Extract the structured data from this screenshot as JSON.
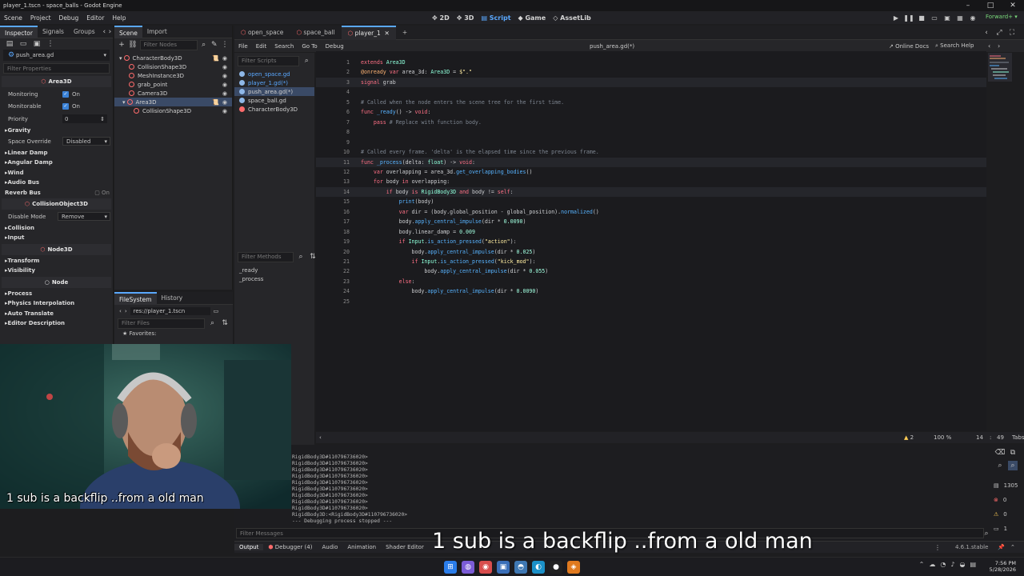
{
  "window": {
    "title": "player_1.tscn - space_balls - Godot Engine"
  },
  "menubar": {
    "items": [
      "Scene",
      "Project",
      "Debug",
      "Editor",
      "Help"
    ],
    "workspaces": [
      "2D",
      "3D",
      "Script",
      "Game",
      "AssetLib"
    ],
    "renderer": "Forward+"
  },
  "inspector": {
    "tabs": [
      "Inspector",
      "Signals",
      "Groups"
    ],
    "resource": "push_area.gd",
    "filter_placeholder": "Filter Properties",
    "class_area": "Area3D",
    "monitoring_label": "Monitoring",
    "monitoring_value": "On",
    "monitorable_label": "Monitorable",
    "monitorable_value": "On",
    "priority_label": "Priority",
    "priority_value": "0",
    "gravity": "Gravity",
    "space_override_label": "Space Override",
    "space_override_value": "Disabled",
    "linear_damp": "Linear Damp",
    "angular_damp": "Angular Damp",
    "wind": "Wind",
    "audio_bus": "Audio Bus",
    "reverb_bus": "Reverb Bus",
    "reverb_value": "On",
    "class_collision": "CollisionObject3D",
    "disable_mode_label": "Disable Mode",
    "disable_mode_value": "Remove",
    "collision": "Collision",
    "input": "Input",
    "class_node3d": "Node3D",
    "transform": "Transform",
    "visibility": "Visibility",
    "class_node": "Node",
    "process": "Process",
    "physics_interp": "Physics Interpolation",
    "auto_translate": "Auto Translate",
    "editor_desc": "Editor Description"
  },
  "scene": {
    "tabs": [
      "Scene",
      "Import"
    ],
    "filter_placeholder": "Filter Nodes",
    "nodes": [
      "CharacterBody3D",
      "CollisionShape3D",
      "MeshInstance3D",
      "grab_point",
      "Camera3D",
      "Area3D",
      "CollisionShape3D"
    ]
  },
  "filesystem": {
    "tabs": [
      "FileSystem",
      "History"
    ],
    "path": "res://player_1.tscn",
    "filter_placeholder": "Filter Files",
    "favorites": "Favorites:",
    "root": "res://"
  },
  "scripttabs": [
    "open_space",
    "space_ball",
    "player_1"
  ],
  "scriptmenu": {
    "items": [
      "File",
      "Edit",
      "Search",
      "Go To",
      "Debug"
    ],
    "current": "push_area.gd(*)",
    "online_docs": "Online Docs",
    "search_help": "Search Help"
  },
  "scriptlist": {
    "filter_placeholder": "Filter Scripts",
    "scripts": [
      "open_space.gd",
      "player_1.gd(*)",
      "push_area.gd(*)",
      "space_ball.gd",
      "CharacterBody3D"
    ],
    "methods_placeholder": "Filter Methods",
    "methods": [
      "_ready",
      "_process"
    ]
  },
  "code": [
    {
      "n": "1",
      "t": [
        [
          "kw",
          "extends "
        ],
        [
          "ty",
          "Area3D"
        ]
      ]
    },
    {
      "n": "2",
      "t": [
        [
          "an",
          "@onready "
        ],
        [
          "kw",
          "var "
        ],
        [
          "",
          "area_3d: "
        ],
        [
          "ty",
          "Area3D"
        ],
        [
          "",
          " = "
        ],
        [
          "st",
          "$\".\""
        ]
      ]
    },
    {
      "n": "3",
      "t": [
        [
          "kw",
          "signal "
        ],
        [
          "",
          "grab"
        ]
      ]
    },
    {
      "n": "4",
      "t": []
    },
    {
      "n": "5",
      "t": [
        [
          "cm",
          "# Called when the node enters the scene tree for the first time."
        ]
      ]
    },
    {
      "n": "6",
      "t": [
        [
          "kw",
          "func "
        ],
        [
          "fn",
          "_ready"
        ],
        [
          "",
          "() -> "
        ],
        [
          "kw",
          "void"
        ],
        [
          "",
          ":"
        ]
      ]
    },
    {
      "n": "7",
      "t": [
        [
          "",
          "    "
        ],
        [
          "kw",
          "pass "
        ],
        [
          "cm",
          "# Replace with function body."
        ]
      ]
    },
    {
      "n": "8",
      "t": []
    },
    {
      "n": "9",
      "t": []
    },
    {
      "n": "10",
      "t": [
        [
          "cm",
          "# Called every frame. 'delta' is the elapsed time since the previous frame."
        ]
      ]
    },
    {
      "n": "11",
      "t": [
        [
          "kw",
          "func "
        ],
        [
          "fn",
          "_process"
        ],
        [
          "",
          "(delta: "
        ],
        [
          "ty",
          "float"
        ],
        [
          "",
          ") -> "
        ],
        [
          "kw",
          "void"
        ],
        [
          "",
          ":"
        ]
      ]
    },
    {
      "n": "12",
      "t": [
        [
          "",
          "    "
        ],
        [
          "kw",
          "var "
        ],
        [
          "",
          "overlapping = area_3d."
        ],
        [
          "fn",
          "get_overlapping_bodies"
        ],
        [
          "",
          "()"
        ]
      ]
    },
    {
      "n": "13",
      "t": [
        [
          "",
          "    "
        ],
        [
          "kw",
          "for "
        ],
        [
          "",
          "body "
        ],
        [
          "kw",
          "in "
        ],
        [
          "",
          "overlapping:"
        ]
      ]
    },
    {
      "n": "14",
      "t": [
        [
          "",
          "        "
        ],
        [
          "kw",
          "if "
        ],
        [
          "",
          "body "
        ],
        [
          "kw",
          "is "
        ],
        [
          "ty",
          "RigidBody3D "
        ],
        [
          "kw",
          "and "
        ],
        [
          "",
          "body != "
        ],
        [
          "kw",
          "self"
        ],
        [
          "",
          ":"
        ]
      ]
    },
    {
      "n": "15",
      "t": [
        [
          "",
          "            "
        ],
        [
          "fn",
          "print"
        ],
        [
          "",
          "(body)"
        ]
      ]
    },
    {
      "n": "16",
      "t": [
        [
          "",
          "            "
        ],
        [
          "kw",
          "var "
        ],
        [
          "",
          "dir = (body.global_position - global_position)."
        ],
        [
          "fn",
          "normalized"
        ],
        [
          "",
          "()"
        ]
      ]
    },
    {
      "n": "17",
      "t": [
        [
          "",
          "            body."
        ],
        [
          "fn",
          "apply_central_impulse"
        ],
        [
          "",
          "(dir * "
        ],
        [
          "nm",
          "0.0090"
        ],
        [
          "",
          ")"
        ]
      ]
    },
    {
      "n": "18",
      "t": [
        [
          "",
          "            body.linear_damp = "
        ],
        [
          "nm",
          "0.009"
        ]
      ]
    },
    {
      "n": "19",
      "t": [
        [
          "",
          "            "
        ],
        [
          "kw",
          "if "
        ],
        [
          "ty",
          "Input"
        ],
        [
          "",
          "."
        ],
        [
          "fn",
          "is_action_pressed"
        ],
        [
          "",
          "("
        ],
        [
          "st",
          "\"action\""
        ],
        [
          "",
          "):"
        ]
      ]
    },
    {
      "n": "20",
      "t": [
        [
          "",
          "                body."
        ],
        [
          "fn",
          "apply_central_impulse"
        ],
        [
          "",
          "(dir * "
        ],
        [
          "nm",
          "0.025"
        ],
        [
          "",
          ")"
        ]
      ]
    },
    {
      "n": "21",
      "t": [
        [
          "",
          "                "
        ],
        [
          "kw",
          "if "
        ],
        [
          "ty",
          "Input"
        ],
        [
          "",
          "."
        ],
        [
          "fn",
          "is_action_pressed"
        ],
        [
          "",
          "("
        ],
        [
          "st",
          "\"kick_mod\""
        ],
        [
          "",
          "):"
        ]
      ]
    },
    {
      "n": "22",
      "t": [
        [
          "",
          "                    body."
        ],
        [
          "fn",
          "apply_central_impulse"
        ],
        [
          "",
          "(dir * "
        ],
        [
          "nm",
          "0.055"
        ],
        [
          "",
          ")"
        ]
      ]
    },
    {
      "n": "23",
      "t": [
        [
          "",
          "            "
        ],
        [
          "kw",
          "else"
        ],
        [
          "",
          ":"
        ]
      ]
    },
    {
      "n": "24",
      "t": [
        [
          "",
          "                body."
        ],
        [
          "fn",
          "apply_central_impulse"
        ],
        [
          "",
          "(dir * "
        ],
        [
          "nm",
          "0.0090"
        ],
        [
          "",
          ")"
        ]
      ]
    },
    {
      "n": "25",
      "t": []
    }
  ],
  "edstatus": {
    "warnings": "2",
    "zoom": "100 %",
    "line": "14",
    "col": "49",
    "indent": "Tabs"
  },
  "output": {
    "lines": [
      "RigidBody3D#110796736020>",
      "RigidBody3D#110796736020>",
      "RigidBody3D#110796736020>",
      "RigidBody3D#110796736020>",
      "RigidBody3D#110796736020>",
      "RigidBody3D#110796736020>",
      "RigidBody3D#110796736020>",
      "RigidBody3D#110796736020>",
      "RigidBody3D#110796736020>",
      "RigidBody3D:<RigidBody3D#110796736020>",
      "--- Debugging process stopped ---"
    ],
    "filter_placeholder": "Filter Messages",
    "counts": {
      "all": "1305",
      "errors": "0",
      "warnings": "0",
      "info": "1"
    }
  },
  "bottomtabs": [
    "Output",
    "Debugger (4)",
    "Audio",
    "Animation",
    "Shader Editor"
  ],
  "version": "4.6.1.stable",
  "captions": {
    "small": "1 sub is a backflip ..from a old man",
    "big": "1 sub is a backflip ..from a old man"
  },
  "clock": {
    "time": "7:56 PM",
    "date": "5/28/2026"
  }
}
